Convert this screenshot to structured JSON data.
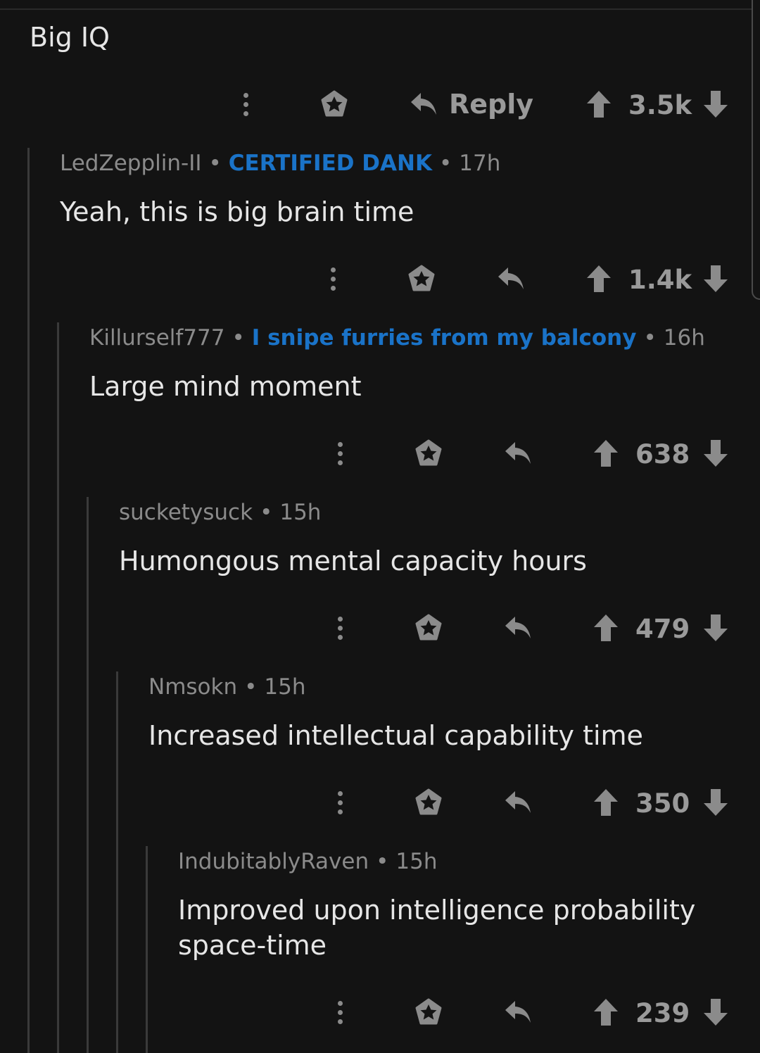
{
  "top_comment": {
    "body": "Big IQ",
    "reply_label": "Reply",
    "score": "3.5k"
  },
  "comments": [
    {
      "author": "LedZepplin-II",
      "flair": "CERTIFIED DANK",
      "time": "17h",
      "body": "Yeah, this is big brain time",
      "score": "1.4k"
    },
    {
      "author": "Killurself777",
      "flair": "I snipe furries from my balcony",
      "time": "16h",
      "body": "Large mind moment",
      "score": "638"
    },
    {
      "author": "sucketysuck",
      "flair": "",
      "time": "15h",
      "body": "Humongous mental capacity hours",
      "score": "479"
    },
    {
      "author": "Nmsokn",
      "flair": "",
      "time": "15h",
      "body": "Increased intellectual capability time",
      "score": "350"
    },
    {
      "author": "IndubitablyRaven",
      "flair": "",
      "time": "15h",
      "body": "Improved upon intelligence probability space-time",
      "score": "239"
    }
  ],
  "separator": "•",
  "icons": {
    "more": "more-vertical-icon",
    "award": "award-star-icon",
    "reply": "reply-arrow-icon",
    "upvote": "upvote-arrow-icon",
    "downvote": "downvote-arrow-icon"
  },
  "colors": {
    "background": "#131313",
    "flair": "#1a73c8",
    "text": "#e6e6e6",
    "meta": "#8b8b8b"
  }
}
